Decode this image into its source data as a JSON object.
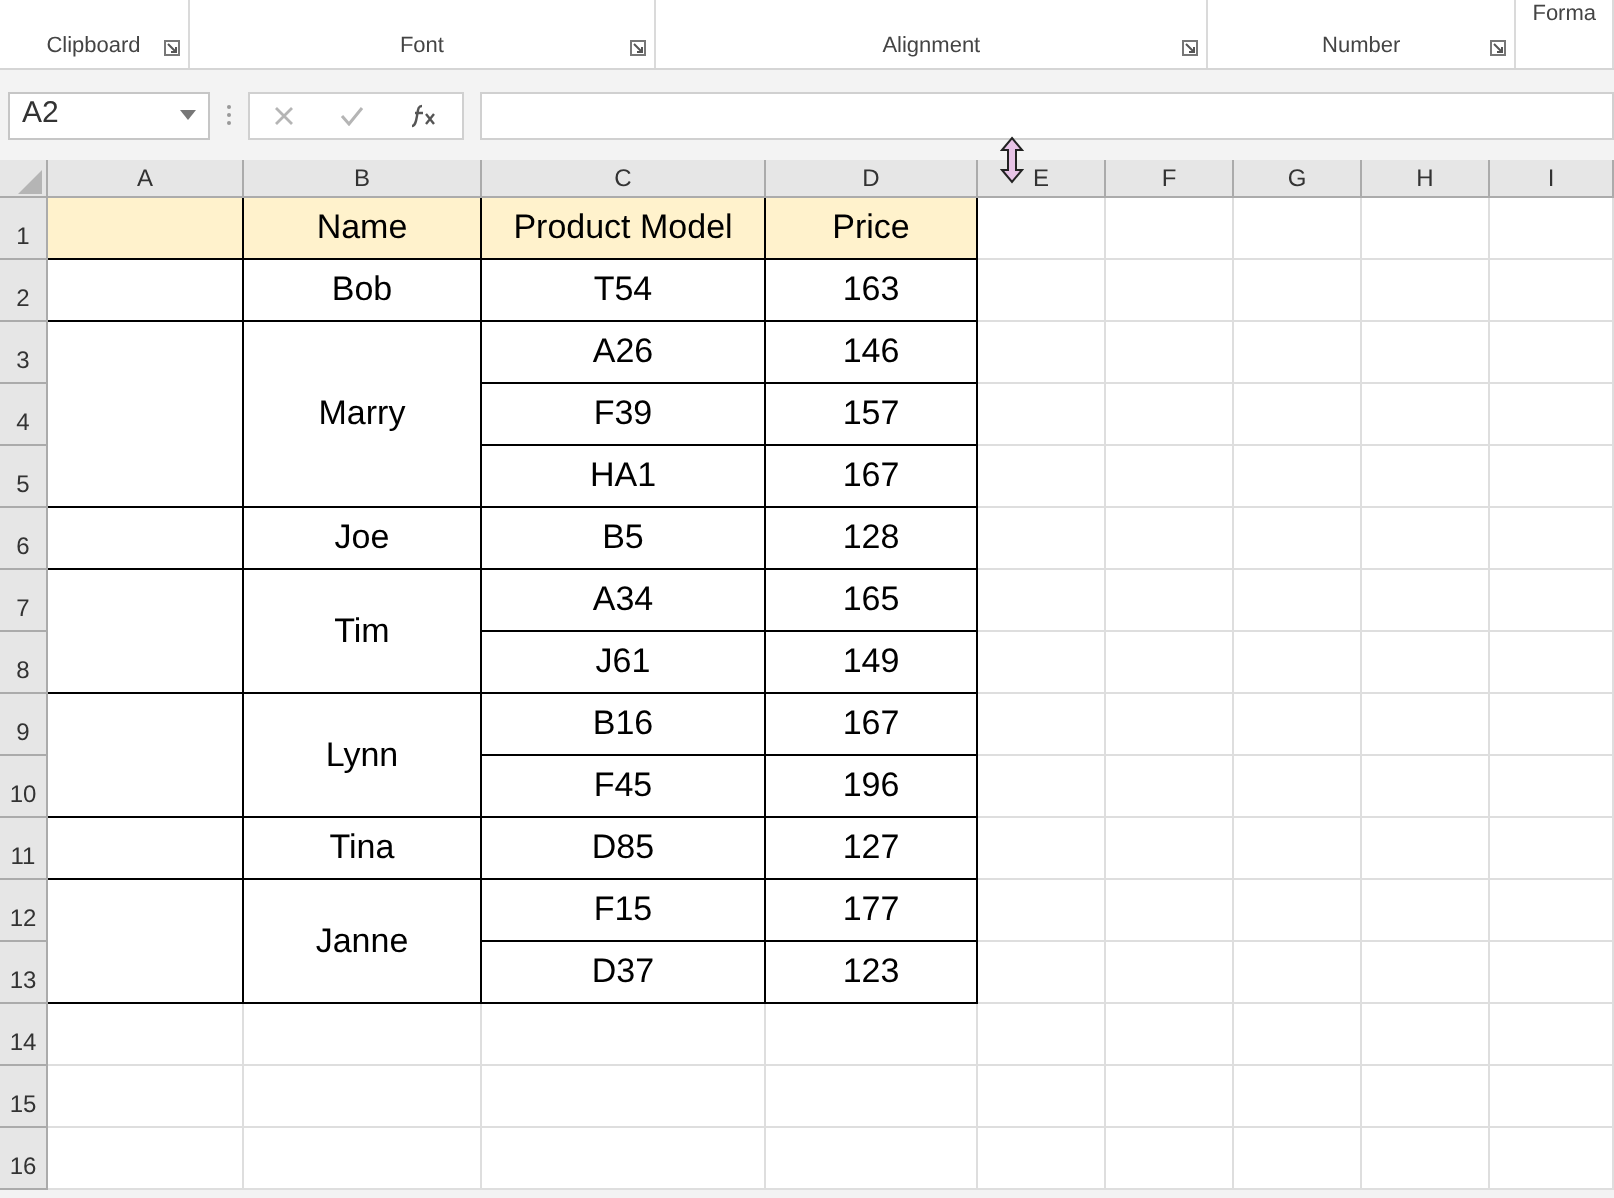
{
  "ribbon": {
    "groups": [
      {
        "label": "Clipboard"
      },
      {
        "label": "Font"
      },
      {
        "label": "Alignment"
      },
      {
        "label": "Number"
      },
      {
        "label": "Forma"
      }
    ]
  },
  "formula_bar": {
    "name_box": "A2"
  },
  "sheet": {
    "columns": [
      "A",
      "B",
      "C",
      "D",
      "E",
      "F",
      "G",
      "H",
      "I"
    ],
    "row_headers": [
      "1",
      "2",
      "3",
      "4",
      "5",
      "6",
      "7",
      "8",
      "9",
      "10",
      "11",
      "12",
      "13",
      "14",
      "15",
      "16"
    ],
    "header": {
      "name": "Name",
      "model": "Product Model",
      "price": "Price"
    },
    "groups": [
      {
        "name": "Bob",
        "items": [
          {
            "model": "T54",
            "price": "163"
          }
        ]
      },
      {
        "name": "Marry",
        "items": [
          {
            "model": "A26",
            "price": "146"
          },
          {
            "model": "F39",
            "price": "157"
          },
          {
            "model": "HA1",
            "price": "167"
          }
        ]
      },
      {
        "name": "Joe",
        "items": [
          {
            "model": "B5",
            "price": "128"
          }
        ]
      },
      {
        "name": "Tim",
        "items": [
          {
            "model": "A34",
            "price": "165"
          },
          {
            "model": "J61",
            "price": "149"
          }
        ]
      },
      {
        "name": "Lynn",
        "items": [
          {
            "model": "B16",
            "price": "167"
          },
          {
            "model": "F45",
            "price": "196"
          }
        ]
      },
      {
        "name": "Tina",
        "items": [
          {
            "model": "D85",
            "price": "127"
          }
        ]
      },
      {
        "name": "Janne",
        "items": [
          {
            "model": "F15",
            "price": "177"
          },
          {
            "model": "D37",
            "price": "123"
          }
        ]
      }
    ]
  }
}
